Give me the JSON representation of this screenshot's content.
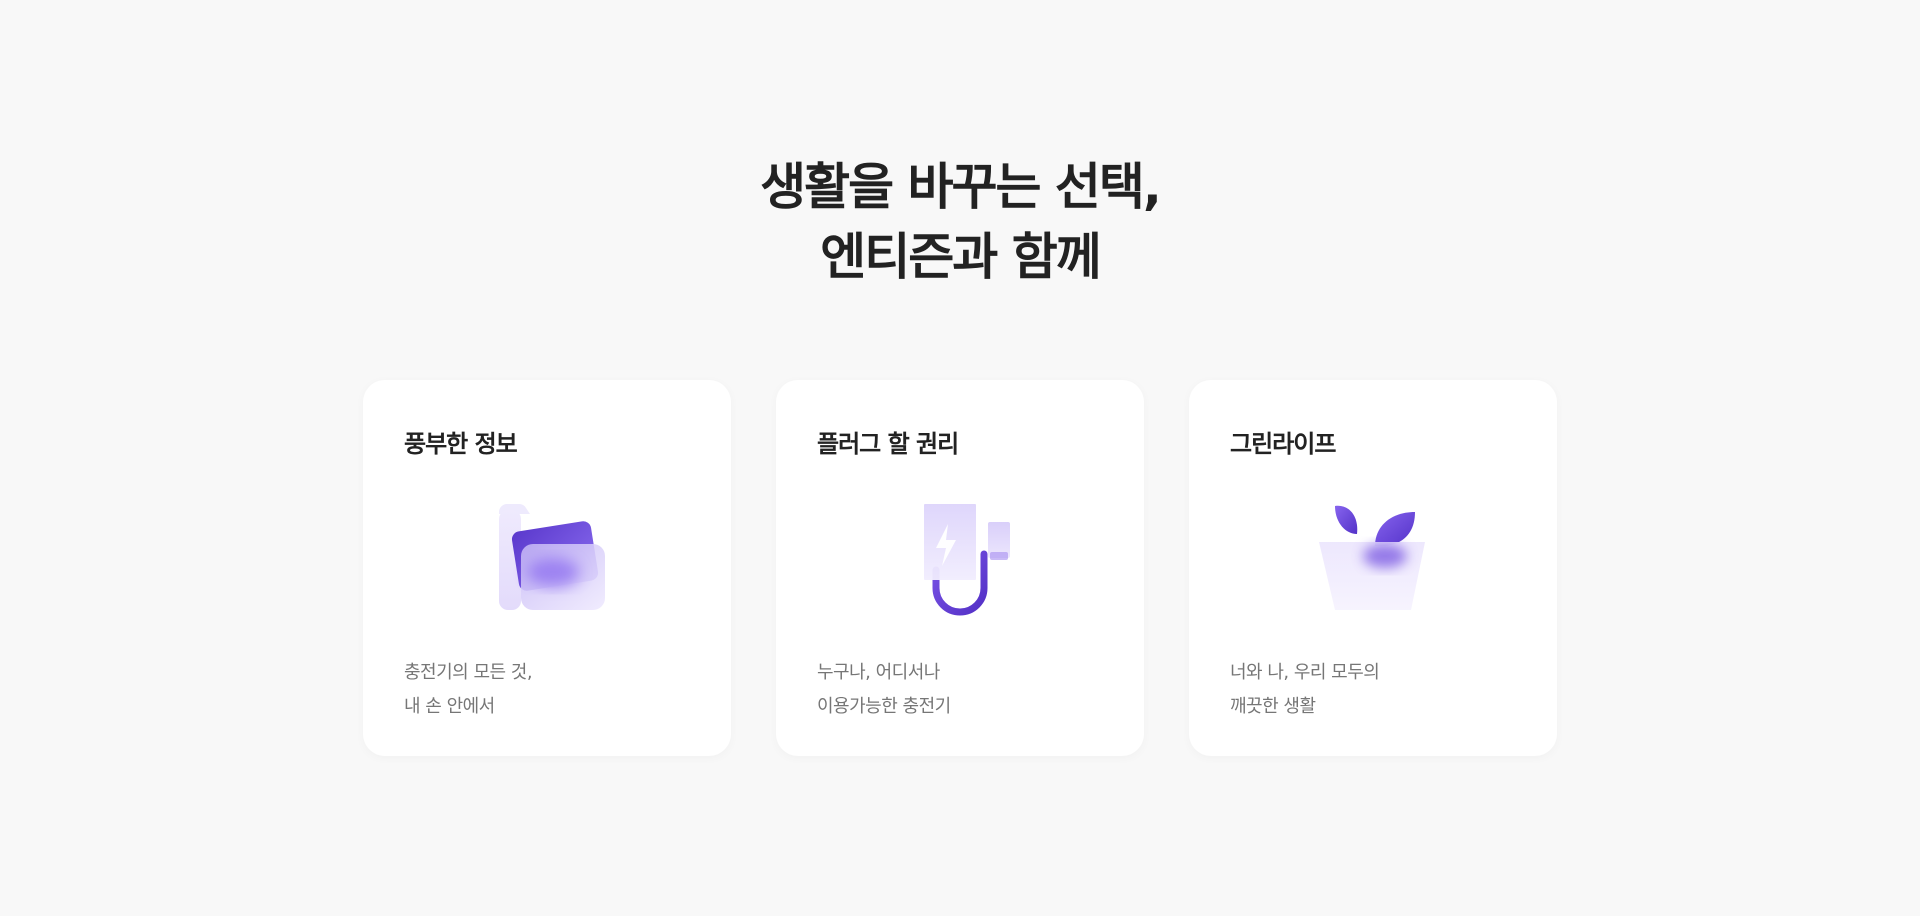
{
  "headline": {
    "line1": "생활을 바꾸는 선택,",
    "line2": "엔티즌과 함께"
  },
  "cards": [
    {
      "title": "풍부한 정보",
      "icon": "folder-icon",
      "desc_line1": "충전기의 모든 것,",
      "desc_line2": "내 손 안에서"
    },
    {
      "title": "플러그 할 권리",
      "icon": "charger-plug-icon",
      "desc_line1": "누구나, 어디서나",
      "desc_line2": "이용가능한 충전기"
    },
    {
      "title": "그린라이프",
      "icon": "plant-pot-icon",
      "desc_line1": "너와 나, 우리 모두의",
      "desc_line2": "깨끗한 생활"
    }
  ],
  "colors": {
    "accent": "#6a45d6",
    "accent_light": "#ebe6fb",
    "background": "#f8f8f8",
    "card": "#ffffff",
    "title_text": "#222222",
    "desc_text": "#767676"
  }
}
